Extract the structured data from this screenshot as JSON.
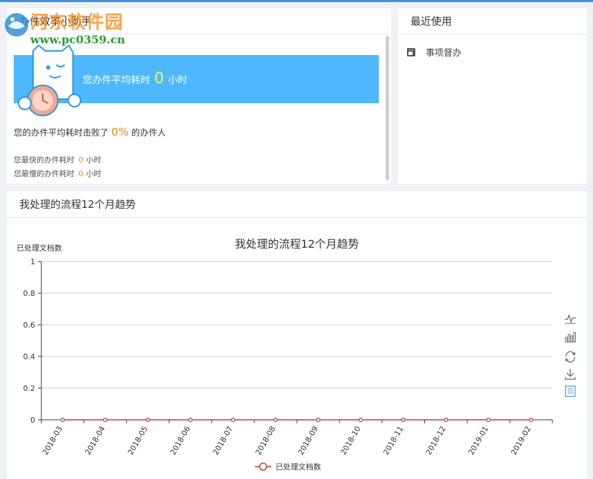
{
  "efficiency_panel": {
    "title": "办件效率小助手",
    "banner_prefix": "您办件平均耗时",
    "banner_value": "0",
    "banner_unit": "小时",
    "beat_prefix": "您的办件平均耗时击败了",
    "beat_value": "0%",
    "beat_suffix": "的办件人",
    "fastest_label": "您最快的办件耗时",
    "fastest_value": "0",
    "fastest_unit": "小时",
    "slowest_label": "您最慢的办件耗时",
    "slowest_value": "0",
    "slowest_unit": "小时"
  },
  "recent_panel": {
    "title": "最近使用",
    "items": [
      {
        "label": "事项督办"
      }
    ]
  },
  "chart_panel": {
    "title": "我处理的流程12个月趋势",
    "toolbox": [
      "line-chart-icon",
      "bar-chart-icon",
      "refresh-icon",
      "download-icon",
      "data-view-icon"
    ]
  },
  "watermark": {
    "name": "河东软件园",
    "url": "www.pc0359.cn"
  },
  "colors": {
    "banner": "#4db8ff",
    "accent_value": "#f08a00",
    "series": "#c23531"
  },
  "chart_data": {
    "type": "line",
    "title": "我处理的流程12个月趋势",
    "ylabel": "已处理文档数",
    "xlabel": "",
    "categories": [
      "2018-03",
      "2018-04",
      "2018-05",
      "2018-06",
      "2018-07",
      "2018-08",
      "2018-09",
      "2018-10",
      "2018-11",
      "2018-12",
      "2019-01",
      "2019-02"
    ],
    "series": [
      {
        "name": "已处理文档数",
        "values": [
          0,
          0,
          0,
          0,
          0,
          0,
          0,
          0,
          0,
          0,
          0,
          0
        ]
      }
    ],
    "ylim": [
      0,
      1
    ],
    "yticks": [
      "0",
      "0.2",
      "0.4",
      "0.6",
      "0.8",
      "1"
    ],
    "grid": true,
    "legend": "bottom-center"
  }
}
